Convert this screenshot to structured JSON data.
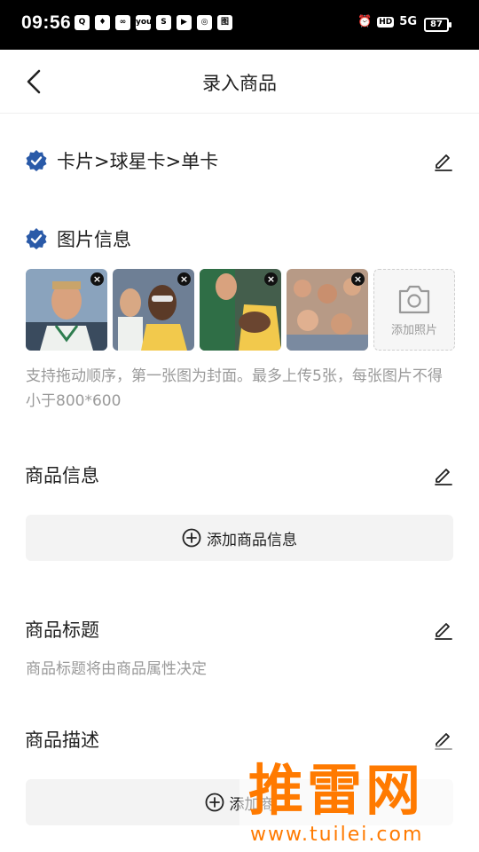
{
  "status_bar": {
    "time": "09:56",
    "app_icons": [
      "Q",
      "♦",
      "∞",
      "you",
      "S",
      "▶",
      "◎",
      "图"
    ],
    "network": "5G",
    "hd": "HD",
    "battery": "87"
  },
  "header": {
    "title": "录入商品"
  },
  "category": {
    "path": "卡片>球星卡>单卡"
  },
  "images_section": {
    "heading": "图片信息",
    "photos": [
      {
        "icon": "player-photo-1"
      },
      {
        "icon": "player-photo-2"
      },
      {
        "icon": "player-photo-3"
      },
      {
        "icon": "player-photo-4"
      }
    ],
    "add_label": "添加照片",
    "hint": "支持拖动顺序，第一张图为封面。最多上传5张，每张图片不得小于800*600"
  },
  "product_info": {
    "heading": "商品信息",
    "add_label": "添加商品信息"
  },
  "product_title": {
    "heading": "商品标题",
    "hint": "商品标题将由商品属性决定"
  },
  "product_description": {
    "heading": "商品描述",
    "add_label": "添加商"
  },
  "watermark": {
    "logo": "推雷网",
    "url": "www.tuilei.com"
  },
  "colors": {
    "accent_blue": "#2a5aa8",
    "text": "#222222",
    "hint": "#9a9a9a",
    "watermark": "#ff7a00"
  }
}
